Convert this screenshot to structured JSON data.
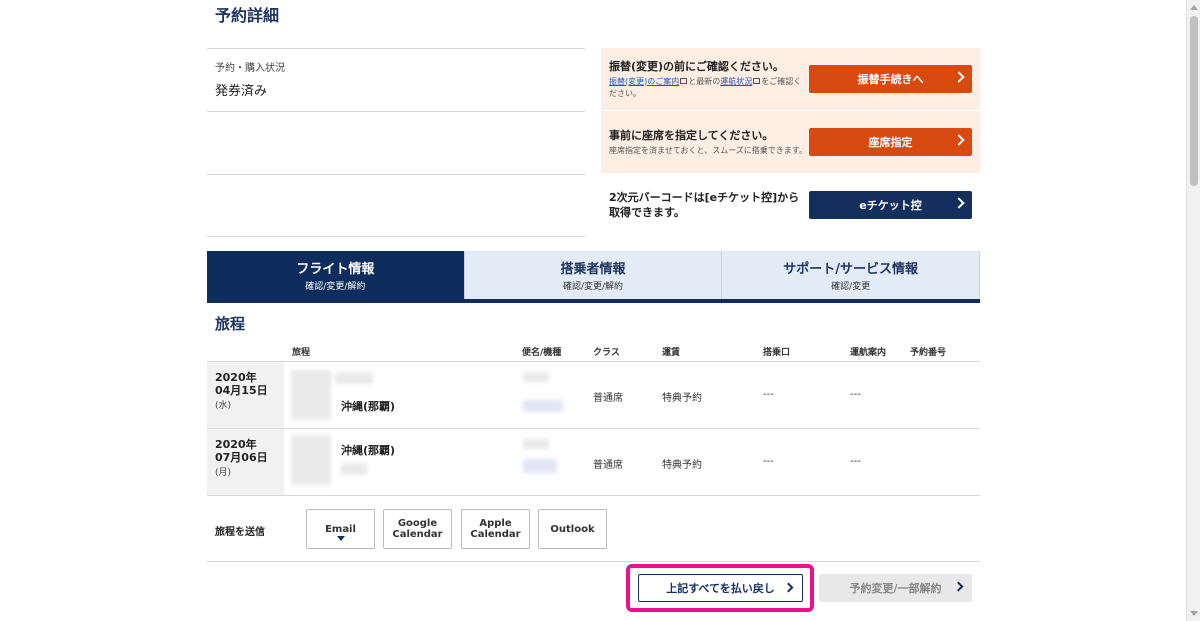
{
  "page_title": "予約詳細",
  "status": {
    "label": "予約・購入状況",
    "value": "発券済み"
  },
  "notices": [
    {
      "title": "振替(変更)の前にご確認ください。",
      "sub_link1": "振替(変更)のご案内",
      "sub_mid": "と最新の",
      "sub_link2": "運航状況",
      "sub_end": "をご確認ください。",
      "button": "振替手続きへ"
    },
    {
      "title": "事前に座席を指定してください。",
      "sub": "座席指定を済ませておくと、スムーズに搭乗できます。",
      "button": "座席指定"
    },
    {
      "title": "2次元バーコードは[eチケット控]から取得できます。",
      "button": "eチケット控"
    }
  ],
  "tabs": [
    {
      "title": "フライト情報",
      "sub": "確認/変更/解約"
    },
    {
      "title": "搭乗者情報",
      "sub": "確認/変更/解約"
    },
    {
      "title": "サポート/サービス情報",
      "sub": "確認/変更"
    }
  ],
  "itinerary": {
    "title": "旅程",
    "headers": {
      "route": "旅程",
      "flight": "便名/機種",
      "class": "クラス",
      "fare": "運賃",
      "gate": "搭乗口",
      "flight_status": "運航案内",
      "booking_number": "予約番号"
    },
    "rows": [
      {
        "year": "2020年",
        "md": "04月15日",
        "wd": "(水)",
        "dest": "沖縄(那覇)",
        "class": "普通席",
        "fare": "特典予約",
        "gate": "---",
        "status": "---"
      },
      {
        "year": "2020年",
        "md": "07月06日",
        "wd": "(月)",
        "dest": "沖縄(那覇)",
        "class": "普通席",
        "fare": "特典予約",
        "gate": "---",
        "status": "---"
      }
    ]
  },
  "send": {
    "label": "旅程を送信",
    "email": "Email",
    "google_1": "Google",
    "google_2": "Calendar",
    "apple_1": "Apple",
    "apple_2": "Calendar",
    "outlook": "Outlook"
  },
  "actions": {
    "refund_all": "上記すべてを払い戻し",
    "change": "予約変更/一部解約"
  },
  "colors": {
    "navy": "#0e2d5c",
    "orange_button": "#d84a10",
    "orange_notice_bg": "#fdeee3",
    "highlight": "#ec0f8e"
  }
}
